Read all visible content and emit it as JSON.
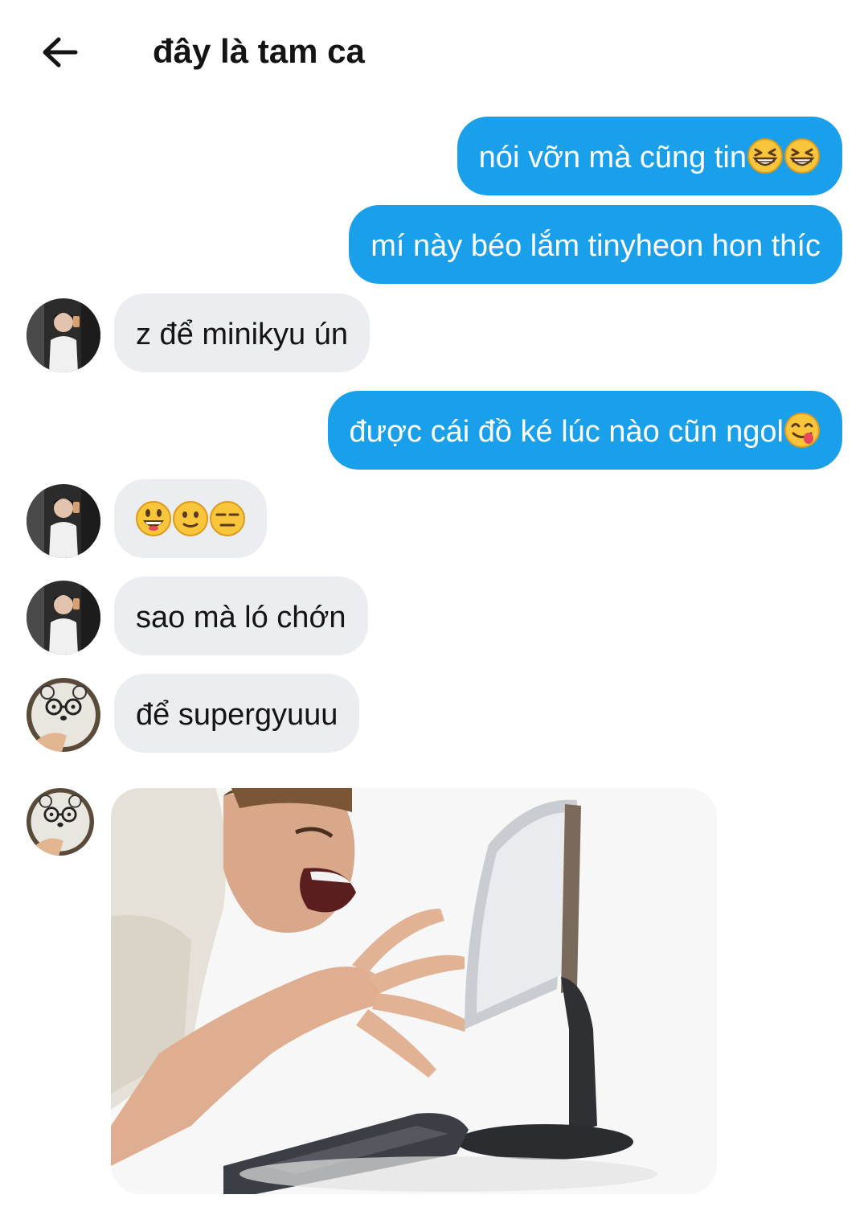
{
  "header": {
    "back_icon": "arrow-left-icon",
    "title": "đây là tam ca"
  },
  "colors": {
    "outgoing_bubble": "#1aa0ea",
    "incoming_bubble": "#ebedf0",
    "outgoing_text": "#ffffff",
    "incoming_text": "#141414",
    "background": "#ffffff"
  },
  "messages": [
    {
      "direction": "out",
      "text": "nói vỡn mà cũng tin",
      "emojis": [
        "grinning-squinting-face",
        "grinning-squinting-face"
      ]
    },
    {
      "direction": "out",
      "text": "mí này béo lắm tinyheon hon thíc",
      "emojis": []
    },
    {
      "direction": "in",
      "sender_avatar": "avatar-mirror-selfie",
      "text": "z để minikyu ún",
      "emojis": []
    },
    {
      "direction": "out",
      "text": "được cái đồ ké lúc nào cũn ngol",
      "emojis": [
        "face-savoring-food"
      ]
    },
    {
      "direction": "in",
      "sender_avatar": "avatar-mirror-selfie",
      "text": "",
      "emojis": [
        "grinning-face-big-eyes",
        "slightly-smiling-face",
        "unamused-face"
      ]
    },
    {
      "direction": "in",
      "sender_avatar": "avatar-mirror-selfie",
      "text": "sao mà ló chớn",
      "emojis": []
    },
    {
      "direction": "in",
      "sender_avatar": "avatar-bear-glasses",
      "text": "để supergyuuu",
      "emojis": []
    },
    {
      "direction": "in",
      "sender_avatar": "avatar-bear-glasses",
      "type": "image",
      "image": "man-screaming-at-computer-photo"
    }
  ]
}
